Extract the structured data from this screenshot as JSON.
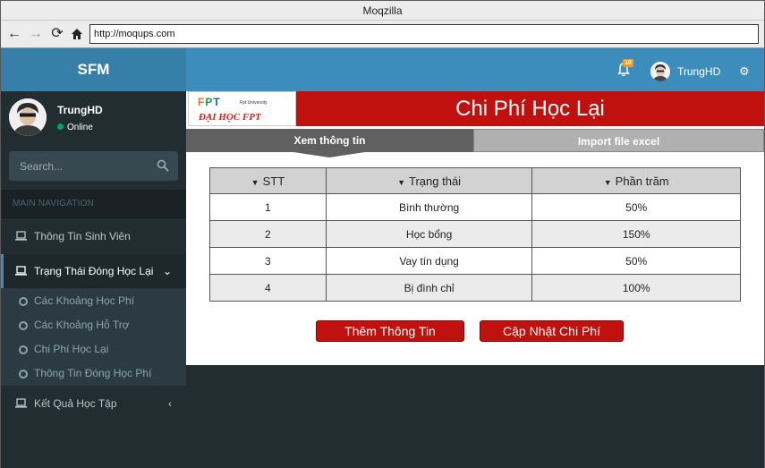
{
  "browser": {
    "window_title": "Moqzilla",
    "url": "http://moqups.com"
  },
  "header": {
    "brand": "SFM",
    "notification_count": "10",
    "username": "TrungHD"
  },
  "sidebar": {
    "user_name": "TrungHD",
    "status": "Online",
    "search_placeholder": "Search...",
    "section_title": "MAIN NAVIGATION",
    "items": [
      {
        "label": "Thông Tin Sinh Viên"
      },
      {
        "label": "Trạng Thái Đóng Học Lại"
      },
      {
        "label": "Kết Quả Học Tập"
      }
    ],
    "subitems": [
      {
        "label": "Các Khoảng Học Phí"
      },
      {
        "label": "Các Khoảng Hỗ Trợ"
      },
      {
        "label": "Chi Phí Học Lại"
      },
      {
        "label": "Thông Tin Đóng Học Phí"
      }
    ]
  },
  "main": {
    "logo": {
      "fpt": "FPT",
      "university": "Fpt University",
      "name": "ĐẠI HỌC FPT"
    },
    "title": "Chi Phí Học Lại",
    "tabs": [
      {
        "label": "Xem thông tin"
      },
      {
        "label": "Import file excel"
      }
    ],
    "table": {
      "columns": [
        "STT",
        "Trạng thái",
        "Phần trăm"
      ],
      "rows": [
        [
          "1",
          "Bình thường",
          "50%"
        ],
        [
          "2",
          "Học bổng",
          "150%"
        ],
        [
          "3",
          "Vay tín dụng",
          "50%"
        ],
        [
          "4",
          "Bị đình chỉ",
          "100%"
        ]
      ]
    },
    "buttons": {
      "add": "Thêm Thông Tin",
      "update": "Cập Nhật Chi Phí"
    }
  },
  "colors": {
    "header_blue": "#3c8dbc",
    "brand_blue": "#367fa9",
    "sidebar_dark": "#222d32",
    "accent_red": "#c0110f",
    "badge_orange": "#f39c12",
    "online_green": "#00a65a"
  }
}
